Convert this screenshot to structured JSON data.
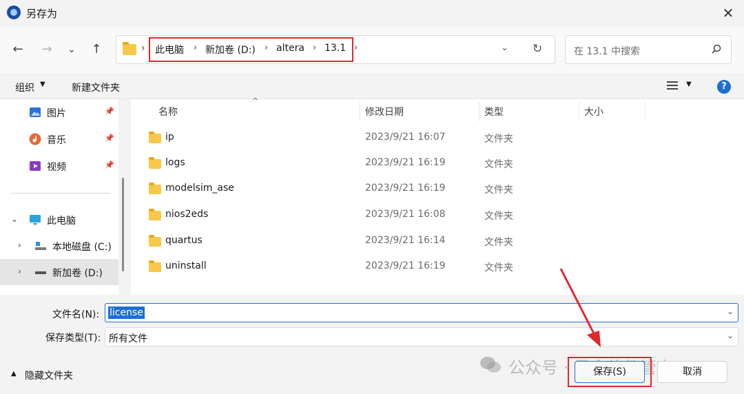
{
  "window": {
    "title": "另存为",
    "close_glyph": "✕"
  },
  "nav": {
    "back": "←",
    "forward": "→",
    "recent": "⌄",
    "up": "↑"
  },
  "address": {
    "sep_glyph": "›",
    "crumbs": [
      "此电脑",
      "新加卷 (D:)",
      "altera",
      "13.1"
    ],
    "dropdown_glyph": "⌄",
    "refresh_glyph": "↻"
  },
  "search": {
    "placeholder": "在 13.1 中搜索"
  },
  "commands": {
    "organize": "组织",
    "new_folder": "新建文件夹",
    "help": "?"
  },
  "sidebar": {
    "quick": [
      {
        "label": "图片",
        "icon": "pictures-icon",
        "color": "#2d6fdb"
      },
      {
        "label": "音乐",
        "icon": "music-icon",
        "color": "#e5683a"
      },
      {
        "label": "视频",
        "icon": "videos-icon",
        "color": "#8a3ac7"
      }
    ],
    "this_pc": "此电脑",
    "drives": [
      "本地磁盘 (C:)",
      "新加卷 (D:)"
    ],
    "pin_glyph": "📌"
  },
  "columns": {
    "name": "名称",
    "modified": "修改日期",
    "type": "类型",
    "size": "大小"
  },
  "files": [
    {
      "name": "ip",
      "modified": "2023/9/21 16:07",
      "type": "文件夹"
    },
    {
      "name": "logs",
      "modified": "2023/9/21 16:19",
      "type": "文件夹"
    },
    {
      "name": "modelsim_ase",
      "modified": "2023/9/21 16:19",
      "type": "文件夹"
    },
    {
      "name": "nios2eds",
      "modified": "2023/9/21 16:08",
      "type": "文件夹"
    },
    {
      "name": "quartus",
      "modified": "2023/9/21 16:14",
      "type": "文件夹"
    },
    {
      "name": "uninstall",
      "modified": "2023/9/21 16:19",
      "type": "文件夹"
    }
  ],
  "footer": {
    "filename_label": "文件名(N):",
    "filename_value": "license",
    "filetype_label": "保存类型(T):",
    "filetype_value": "所有文件",
    "hide_folders": "隐藏文件夹",
    "save": "保存(S)",
    "cancel": "取消",
    "watermark": "公众号 · 最全软件管家"
  },
  "colors": {
    "accent": "#1c6fd6",
    "annotation_red": "#e3262b",
    "folder": "#f8c84a"
  }
}
